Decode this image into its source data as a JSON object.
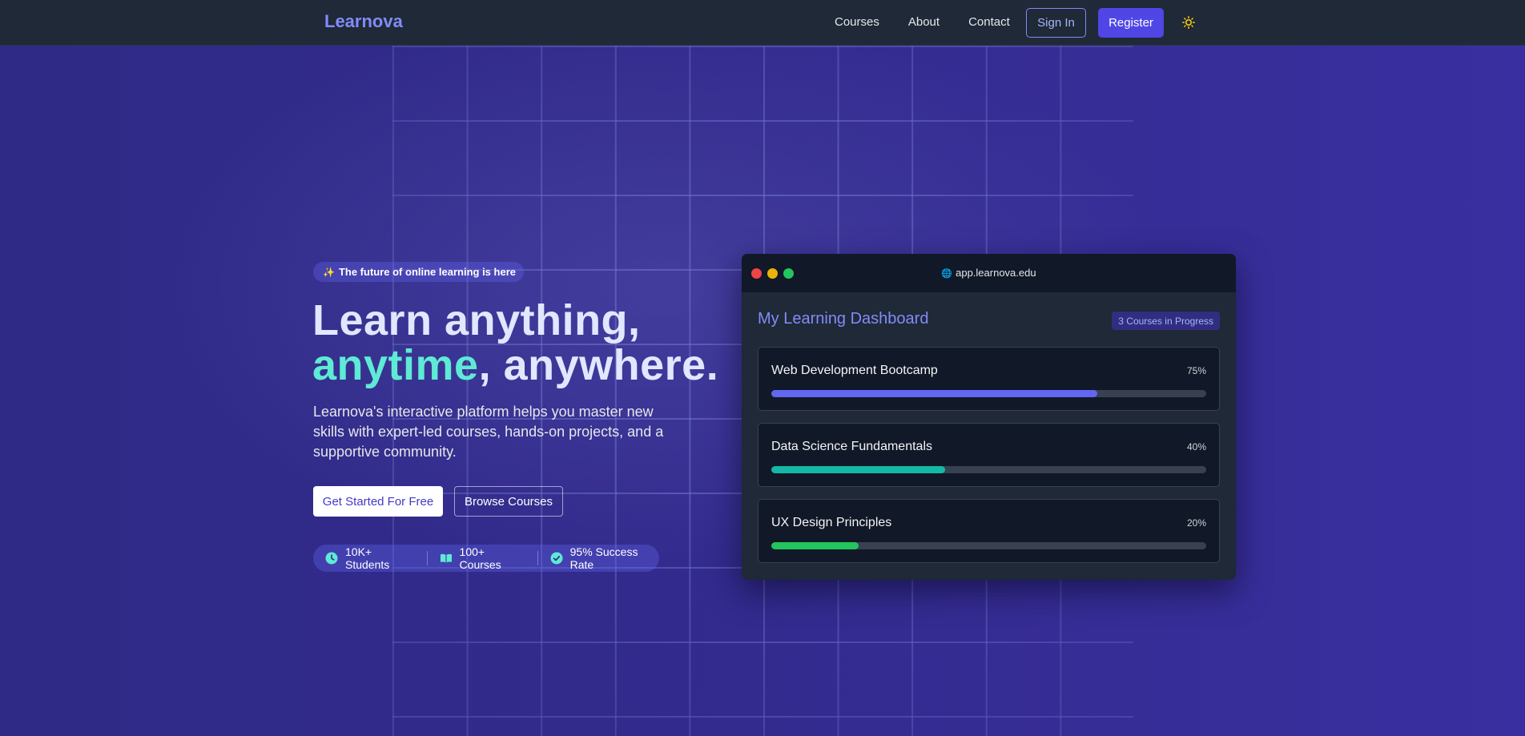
{
  "nav": {
    "logo": "Learnova",
    "links": [
      "Courses",
      "About",
      "Contact"
    ],
    "signin_label": "Sign In",
    "register_label": "Register",
    "theme_icon": "sun-icon"
  },
  "hero": {
    "tagline_icon": "star-icon",
    "tagline": "The future of online learning is here",
    "headline_line1": "Learn anything,",
    "headline_accent": "anytime",
    "headline_rest": ", anywhere.",
    "lede": "Learnova's interactive platform helps you master new skills with expert-led courses, hands-on projects, and a supportive community.",
    "primary_cta": "Get Started For Free",
    "secondary_cta": "Browse Courses",
    "stats": [
      {
        "icon": "clock-icon",
        "label": "10K+ Students"
      },
      {
        "icon": "book-icon",
        "label": "100+ Courses"
      },
      {
        "icon": "check-circle-icon",
        "label": "95% Success Rate"
      }
    ]
  },
  "dashboard": {
    "url": "app.learnova.edu",
    "url_icon": "globe-icon",
    "title": "My Learning Dashboard",
    "badge": "3 Courses in Progress",
    "courses": [
      {
        "name": "Web Development Bootcamp",
        "percent_label": "75%",
        "progress": 0.75,
        "color": "#6366f1"
      },
      {
        "name": "Data Science Fundamentals",
        "percent_label": "40%",
        "progress": 0.4,
        "color": "#14b8a6"
      },
      {
        "name": "UX Design Principles",
        "percent_label": "20%",
        "progress": 0.2,
        "color": "#22c55e"
      }
    ]
  },
  "colors": {
    "background": "#312a8a",
    "nav": "#1f2937",
    "brand": "#818cf8",
    "accent": "#5eead4",
    "register": "#4f46e5"
  }
}
